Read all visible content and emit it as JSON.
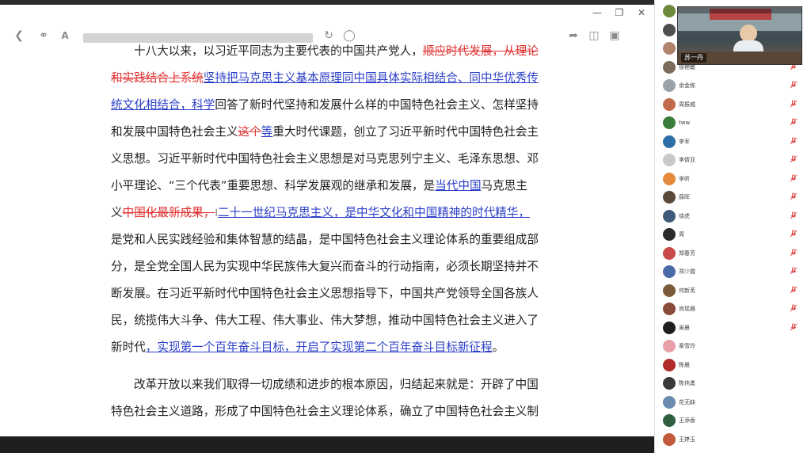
{
  "document": {
    "lines": [
      {
        "indent": true,
        "segs": [
          {
            "t": "十八大以来，以习近平同志为主要代表的中国共产党人，",
            "c": ""
          },
          {
            "t": "顺应时代发展，从理论",
            "c": "del"
          }
        ]
      },
      {
        "segs": [
          {
            "t": "和实践结合上系统",
            "c": "del"
          },
          {
            "t": "坚持把马克思主义基本原理同中国具体实际相结合、同中华优秀传",
            "c": "ins"
          }
        ]
      },
      {
        "segs": [
          {
            "t": "统文化相结合，科学",
            "c": "ins"
          },
          {
            "t": "回答了新时代坚持和发展什么样的中国特色社会主义、怎样坚持",
            "c": ""
          }
        ]
      },
      {
        "segs": [
          {
            "t": "和发展中国特色社会主义",
            "c": ""
          },
          {
            "t": "这个",
            "c": "del"
          },
          {
            "t": "等",
            "c": "ins"
          },
          {
            "t": "重大时代课题，创立了习近平新时代中国特色社会主",
            "c": ""
          }
        ]
      },
      {
        "segs": [
          {
            "t": "义思想。习近平新时代中国特色社会主义思想是对马克思列宁主义、毛泽东思想、邓",
            "c": ""
          }
        ]
      },
      {
        "segs": [
          {
            "t": "小平理论、“三个代表”重要思想、科学发展观的继承和发展，是",
            "c": ""
          },
          {
            "t": "当代中国",
            "c": "ins"
          },
          {
            "t": "马克思主",
            "c": ""
          }
        ]
      },
      {
        "segs": [
          {
            "t": "义",
            "c": ""
          },
          {
            "t": "中国化最新成果，",
            "c": "del"
          },
          {
            "t": "I",
            "c": "cursor"
          },
          {
            "t": "二十一世纪马克思主义，是中华文化和中国精神的时代精华，",
            "c": "ins"
          }
        ]
      },
      {
        "segs": [
          {
            "t": "是党和人民实践经验和集体智慧的结晶，是中国特色社会主义理论体系的重要组成部",
            "c": ""
          }
        ]
      },
      {
        "segs": [
          {
            "t": "分，是全党全国人民为实现中华民族伟大复兴而奋斗的行动指南，必须长期坚持并不",
            "c": ""
          }
        ]
      },
      {
        "segs": [
          {
            "t": "断发展。在习近平新时代中国特色社会主义思想指导下，中国共产党领导全国各族人",
            "c": ""
          }
        ]
      },
      {
        "segs": [
          {
            "t": "民，统揽伟大斗争、伟大工程、伟大事业、伟大梦想，推动中国特色社会主义进入了",
            "c": ""
          }
        ]
      },
      {
        "segs": [
          {
            "t": "新时代",
            "c": ""
          },
          {
            "t": "，实现第一个百年奋斗目标，开启了实现第二个百年奋斗目标新征程",
            "c": "ins"
          },
          {
            "t": "。",
            "c": ""
          }
        ]
      },
      {
        "gap": true,
        "segs": []
      },
      {
        "indent": true,
        "segs": [
          {
            "t": "改革开放以来我们取得一切成绩和进步的根本原因，归结起来就是：开辟了中国",
            "c": ""
          }
        ]
      },
      {
        "segs": [
          {
            "t": "特色社会主义道路，形成了中国特色社会主义理论体系，确立了中国特色社会主义制",
            "c": ""
          }
        ]
      }
    ]
  },
  "video": {
    "caption": "苏一丹"
  },
  "participants": [
    {
      "name": "",
      "color": "#6b8a3c",
      "mic": true
    },
    {
      "name": "",
      "color": "#4f4f4f",
      "mic": true
    },
    {
      "name": "",
      "color": "#b0836a",
      "mic": true
    },
    {
      "name": "徐艳敏",
      "color": "#7b6b5a",
      "mic": true
    },
    {
      "name": "余金栋",
      "color": "#9aa3a8",
      "mic": true
    },
    {
      "name": "周振威",
      "color": "#c26b4a",
      "mic": true
    },
    {
      "name": "tww",
      "color": "#3a7d3a",
      "mic": true
    },
    {
      "name": "李军",
      "color": "#2f6fa8",
      "mic": true
    },
    {
      "name": "李倩亚",
      "color": "#c9c9c9",
      "mic": true
    },
    {
      "name": "李昕",
      "color": "#e48a3a",
      "mic": true
    },
    {
      "name": "薛晖",
      "color": "#5a4a3a",
      "mic": true
    },
    {
      "name": "徐虎",
      "color": "#3f5a7a",
      "mic": true
    },
    {
      "name": "周",
      "color": "#2b2b2b",
      "mic": true
    },
    {
      "name": "郑春芳",
      "color": "#c84a4a",
      "mic": true
    },
    {
      "name": "郑少霞",
      "color": "#4a6aa8",
      "mic": true
    },
    {
      "name": "何新芙",
      "color": "#7a5a3a",
      "mic": true
    },
    {
      "name": "尚瑶雅",
      "color": "#8a4a3a",
      "mic": true
    },
    {
      "name": "吴晨",
      "color": "#1f1f1f",
      "mic": true
    },
    {
      "name": "秦雪玲",
      "color": "#e8a0a8",
      "mic": false
    },
    {
      "name": "陈晨",
      "color": "#b02a2a",
      "mic": false
    },
    {
      "name": "陈伟勇",
      "color": "#3a3a3a",
      "mic": false
    },
    {
      "name": "花无缺",
      "color": "#6a8ab0",
      "mic": false
    },
    {
      "name": "王添香",
      "color": "#2f5f3f",
      "mic": false
    },
    {
      "name": "王婷玉",
      "color": "#c05a3a",
      "mic": false
    }
  ],
  "icons": {
    "minimize": "minimize-icon",
    "maximize": "restore-icon",
    "close": "close-icon",
    "back": "back-icon",
    "link": "link-icon",
    "font": "font-size-icon",
    "refresh": "refresh-icon",
    "globe": "globe-icon",
    "share": "share-icon",
    "cube": "cube-icon",
    "screenshot": "screenshot-icon",
    "mic_muted": "mic-muted-icon"
  }
}
